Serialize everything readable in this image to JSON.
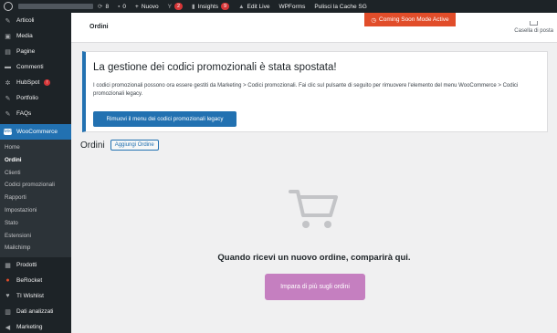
{
  "adminbar": {
    "updates": "8",
    "comments": "0",
    "new_label": "Nuovo",
    "yoast_badge": "2",
    "insights_label": "Insights",
    "insights_badge": "9",
    "edit_live": "Edit Live",
    "wpforms": "WPForms",
    "purge": "Pulisci la Cache SG"
  },
  "sidebar": {
    "items_top": [
      {
        "label": "Articoli",
        "icon": "pin-icon"
      },
      {
        "label": "Media",
        "icon": "media-icon"
      },
      {
        "label": "Pagine",
        "icon": "page-icon"
      },
      {
        "label": "Commenti",
        "icon": "comment-icon"
      },
      {
        "label": "HubSpot",
        "icon": "hubspot-icon",
        "badge": "!"
      },
      {
        "label": "Portfolio",
        "icon": "pin-icon"
      },
      {
        "label": "FAQs",
        "icon": "pin-icon"
      }
    ],
    "woocommerce": "WooCommerce",
    "submenu": [
      "Home",
      "Ordini",
      "Clienti",
      "Codici promozionali",
      "Rapporti",
      "Impostazioni",
      "Stato",
      "Estensioni",
      "Mailchimp"
    ],
    "items_bottom": [
      {
        "label": "Prodotti",
        "icon": "box-icon"
      },
      {
        "label": "BeRocket",
        "icon": "berocket-icon"
      },
      {
        "label": "TI Wishlist",
        "icon": "heart-icon"
      },
      {
        "label": "Dati analizzati",
        "icon": "chart-icon"
      },
      {
        "label": "Marketing",
        "icon": "megaphone-icon"
      }
    ]
  },
  "topbar": {
    "title": "Ordini",
    "coming_soon": "Coming Soon Mode Active",
    "inbox": "Casella di posta"
  },
  "notice": {
    "heading": "La gestione dei codici promozionali è stata spostata!",
    "body": "I codici promozionali possono ora essere gestiti da Marketing > Codici promozionali. Fai clic sul pulsante di seguito per rimuovere l'elemento del menu WooCommerce > Codici promozionali legacy.",
    "button": "Rimuovi il menu dei codici promozionali legacy"
  },
  "page": {
    "heading": "Ordini",
    "add_button": "Aggiungi Ordine"
  },
  "empty_state": {
    "message": "Quando ricevi un nuovo ordine, comparirà qui.",
    "button": "Impara di più sugli ordini"
  }
}
